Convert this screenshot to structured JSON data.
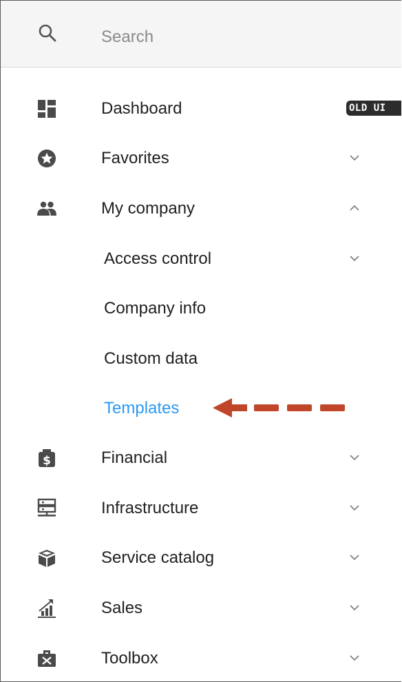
{
  "search": {
    "placeholder": "Search",
    "icon": "search-icon"
  },
  "nav": {
    "dashboard": {
      "label": "Dashboard",
      "icon": "dashboard-icon",
      "badge": "OLD UI"
    },
    "favorites": {
      "label": "Favorites",
      "icon": "star-icon"
    },
    "my_company": {
      "label": "My company",
      "icon": "people-icon",
      "expanded": true
    },
    "access_control": {
      "label": "Access control"
    },
    "company_info": {
      "label": "Company info"
    },
    "custom_data": {
      "label": "Custom data"
    },
    "templates": {
      "label": "Templates",
      "active": true
    },
    "financial": {
      "label": "Financial",
      "icon": "money-bag-icon"
    },
    "infrastructure": {
      "label": "Infrastructure",
      "icon": "server-icon"
    },
    "service_catalog": {
      "label": "Service catalog",
      "icon": "cube-icon"
    },
    "sales": {
      "label": "Sales",
      "icon": "chart-up-icon"
    },
    "toolbox": {
      "label": "Toolbox",
      "icon": "toolbox-icon"
    }
  },
  "colors": {
    "active_text": "#2b9af3",
    "icon": "#4a4a4a",
    "chevron": "#7a7a7a",
    "badge_bg": "#2c2c2c",
    "arrow": "#c0462a",
    "search_bg": "#f5f5f5"
  }
}
